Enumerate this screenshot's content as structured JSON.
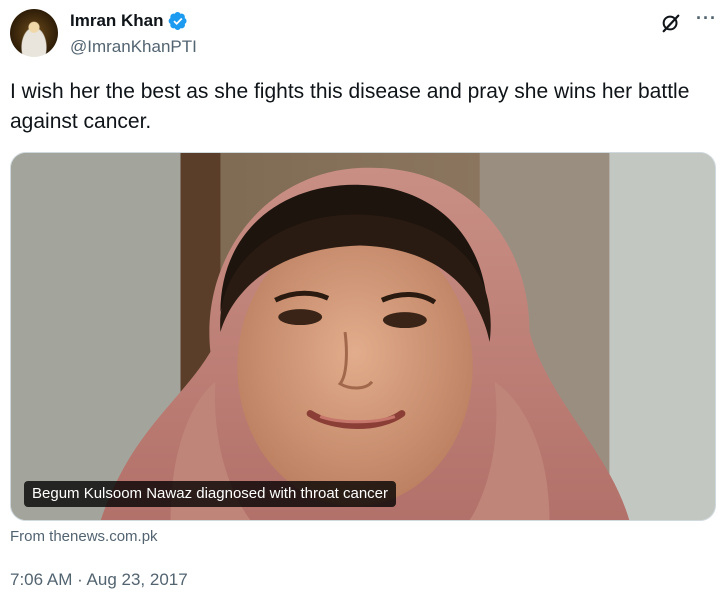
{
  "author": {
    "name": "Imran Khan",
    "handle": "@ImranKhanPTI",
    "verified_icon": "verified-badge-icon",
    "verified_color": "#1d9bf0"
  },
  "header_actions": {
    "grok_icon": "grok-icon",
    "more_icon": "more-options-icon",
    "more_glyph": "···"
  },
  "tweet": {
    "text": "I wish her the best as she fights this disease and pray she wins her battle against cancer."
  },
  "card": {
    "caption": "Begum Kulsoom Nawaz diagnosed with throat cancer",
    "source": "From thenews.com.pk"
  },
  "meta": {
    "timestamp": "7:06 AM · Aug 23, 2017"
  }
}
